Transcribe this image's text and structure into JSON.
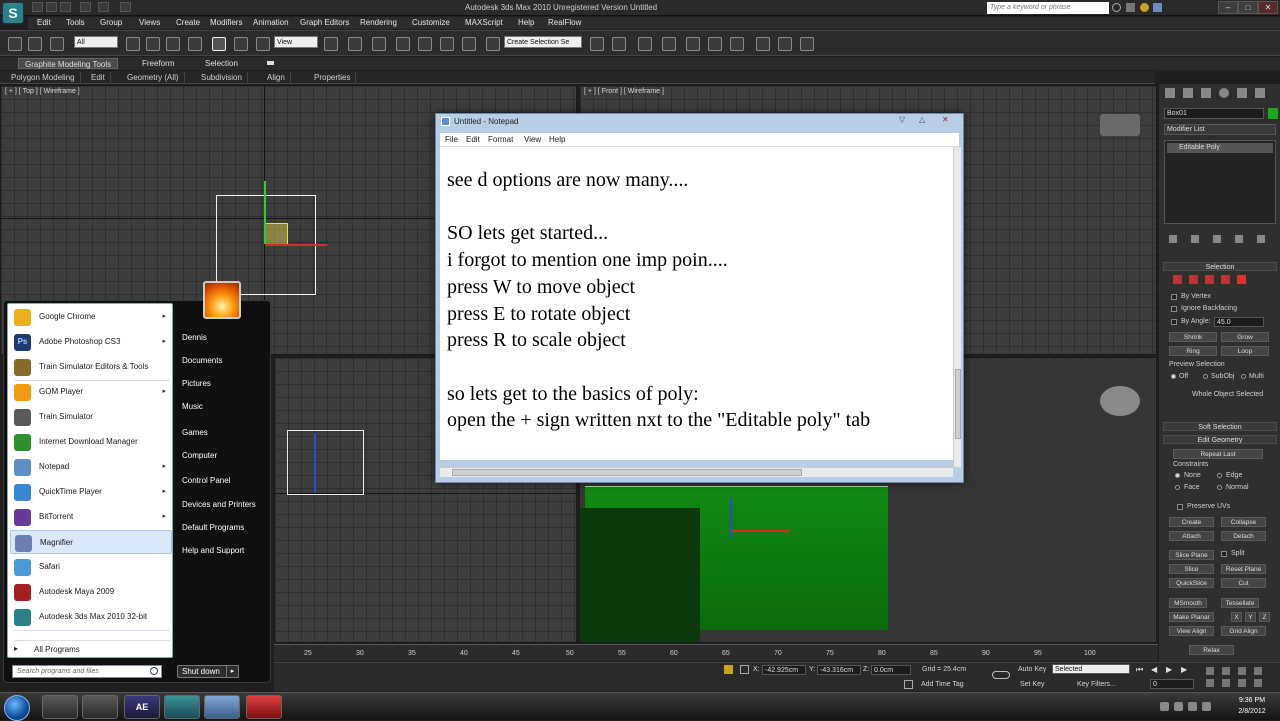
{
  "app": {
    "title": "Autodesk 3ds Max 2010    Unregistered Version     Untitled",
    "logo_letter": "S",
    "search_placeholder": "Type a keyword or phrase"
  },
  "menubar": [
    "Edit",
    "Tools",
    "Group",
    "Views",
    "Create",
    "Modifiers",
    "Animation",
    "Graph Editors",
    "Rendering",
    "Customize",
    "MAXScript",
    "Help",
    "RealFlow"
  ],
  "toolbar": {
    "filter_combo": "All",
    "view_combo": "View",
    "selection_set": "Create Selection Se"
  },
  "ribbon": {
    "tabs": [
      "Graphite Modeling Tools",
      "Freeform",
      "Selection"
    ],
    "subtabs": [
      "Polygon Modeling",
      "Edit",
      "Geometry (All)",
      "Subdivision",
      "Align",
      "Properties"
    ]
  },
  "viewports": {
    "top_label": "[ + ] [ Top ] [ Wireframe ]",
    "front_label": "[ + ] [ Front ] [ Wireframe ]"
  },
  "command_panel": {
    "object_name": "Box01",
    "modifier_list": "Modifier List",
    "stack_item": "Editable Poly",
    "selection_header": "Selection",
    "by_vertex": "By Vertex",
    "ignore_backfacing": "Ignore Backfacing",
    "by_angle": "By Angle:",
    "angle_value": "45.0",
    "shrink": "Shrink",
    "grow": "Grow",
    "ring": "Ring",
    "loop": "Loop",
    "preview_selection": "Preview Selection",
    "preview_off": "Off",
    "preview_subobj": "SubObj",
    "preview_multi": "Multi",
    "whole_object": "Whole Object Selected",
    "soft_selection": "Soft Selection",
    "edit_geometry": "Edit Geometry",
    "repeat_last": "Repeat Last",
    "constraints": "Constraints",
    "c_none": "None",
    "c_edge": "Edge",
    "c_face": "Face",
    "c_normal": "Normal",
    "preserve_uvs": "Preserve UVs",
    "create": "Create",
    "collapse": "Collapse",
    "attach": "Attach",
    "detach": "Detach",
    "slice_plane": "Slice Plane",
    "split": "Split",
    "slice": "Slice",
    "reset_plane": "Reset Plane",
    "quickslice": "QuickSlice",
    "cut": "Cut",
    "msmooth": "MSmooth",
    "tessellate": "Tessellate",
    "make_planar": "Make Planar",
    "x": "X",
    "y": "Y",
    "z": "Z",
    "view_align": "View Align",
    "grid_align": "Grid Align",
    "relax": "Relax"
  },
  "notepad": {
    "title": "Untitled - Notepad",
    "menu": [
      "File",
      "Edit",
      "Format",
      "View",
      "Help"
    ],
    "lines": [
      "see d options are now many....",
      "",
      "SO lets get started...",
      "i forgot to mention one imp poin....",
      "press W to move object",
      "press E to rotate object",
      "press R to scale object",
      "",
      "so lets get to the basics of poly:",
      "open the + sign written nxt to the \"Editable poly\" tab"
    ]
  },
  "start_menu": {
    "programs": [
      {
        "label": "Google Chrome",
        "arrow": true,
        "color": "#e8b020"
      },
      {
        "label": "Adobe Photoshop CS3",
        "arrow": true,
        "color": "#1e3a70",
        "glyph": "Ps"
      },
      {
        "label": "Train Simulator Editors & Tools",
        "arrow": false,
        "color": "#8a6b2a"
      },
      {
        "label": "GOM Player",
        "arrow": true,
        "color": "#f29a12"
      },
      {
        "label": "Train Simulator",
        "arrow": false,
        "color": "#5a5a5a"
      },
      {
        "label": "Internet Download Manager",
        "arrow": false,
        "color": "#2f8f2f"
      },
      {
        "label": "Notepad",
        "arrow": true,
        "color": "#5c8fc7"
      },
      {
        "label": "QuickTime Player",
        "arrow": true,
        "color": "#3a86d6"
      },
      {
        "label": "BitTorrent",
        "arrow": true,
        "color": "#6a3a9a"
      },
      {
        "label": "Magnifier",
        "arrow": false,
        "color": "#6c7fb0"
      },
      {
        "label": "Safari",
        "arrow": false,
        "color": "#4a9ad6"
      },
      {
        "label": "Autodesk Maya 2009",
        "arrow": false,
        "color": "#a32020"
      },
      {
        "label": "Autodesk 3ds Max 2010 32-bit",
        "arrow": false,
        "color": "#2d7f8a"
      }
    ],
    "all_programs": "All Programs",
    "right_items": [
      "Dennis",
      "Documents",
      "Pictures",
      "Music",
      "Games",
      "Computer",
      "Control Panel",
      "Devices and Printers",
      "Default Programs",
      "Help and Support"
    ],
    "search_placeholder": "Search programs and files",
    "shutdown": "Shut down"
  },
  "timeline": {
    "ticks": [
      "25",
      "30",
      "35",
      "40",
      "45",
      "50",
      "55",
      "60",
      "65",
      "70",
      "75",
      "80",
      "85",
      "90",
      "95",
      "100"
    ]
  },
  "status": {
    "x_label": "X:",
    "x_value": "-42.925cm",
    "y_label": "Y:",
    "y_value": "-43.316cm",
    "z_label": "Z:",
    "z_value": "0.0cm",
    "grid": "Grid = 25.4cm",
    "add_time_tag": "Add Time Tag",
    "auto_key": "Auto Key",
    "selected": "Selected",
    "set_key": "Set Key",
    "key_filters": "Key Filters...",
    "frame": "0"
  },
  "taskbar": {
    "apps": [
      "",
      "",
      "AE",
      "",
      "",
      ""
    ],
    "time": "9:36 PM",
    "date": "2/8/2012"
  }
}
